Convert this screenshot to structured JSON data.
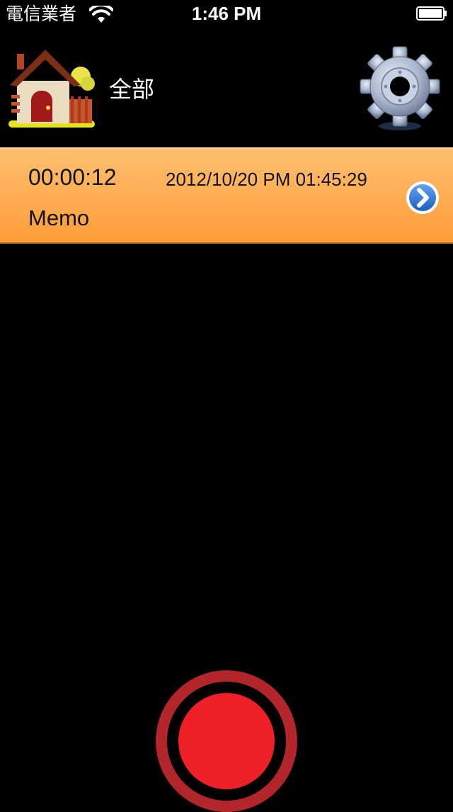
{
  "status_bar": {
    "carrier": "電信業者",
    "time": "1:46 PM",
    "wifi_icon": "wifi-icon",
    "battery_icon": "battery-icon"
  },
  "header": {
    "home_icon": "home-icon",
    "folder_label": "全部",
    "settings_icon": "gear-icon"
  },
  "recordings": [
    {
      "duration": "00:00:12",
      "datetime": "2012/10/20 PM 01:45:29",
      "title": "Memo",
      "disclosure_icon": "chevron-right-icon"
    }
  ],
  "record_button": {
    "icon": "record-icon"
  },
  "colors": {
    "background": "#000000",
    "row_gradient_top": "#ffbf6e",
    "row_gradient_bottom": "#ff9d3a",
    "record_red": "#ee1f26",
    "record_ring": "#b2252a",
    "disclosure_blue": "#2a74d8"
  }
}
